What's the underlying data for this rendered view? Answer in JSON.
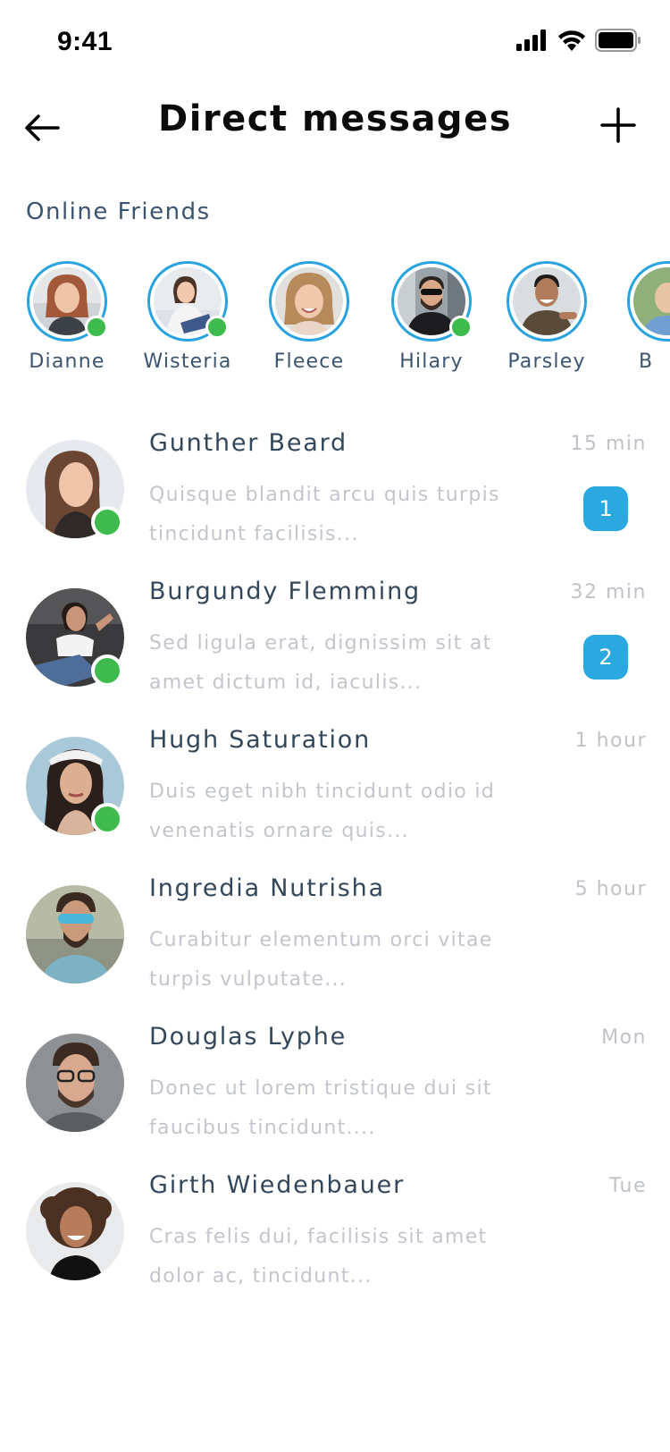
{
  "status_bar": {
    "time": "9:41"
  },
  "header": {
    "title": "Direct messages",
    "back_icon": "arrow-left-icon",
    "add_icon": "plus-icon"
  },
  "online_friends": {
    "title": "Online Friends",
    "friends": [
      {
        "name": "Dianne",
        "online": true
      },
      {
        "name": "Wisteria",
        "online": true
      },
      {
        "name": "Fleece",
        "online": false
      },
      {
        "name": "Hilary",
        "online": true
      },
      {
        "name": "Parsley",
        "online": false
      },
      {
        "name": "B",
        "online": false
      }
    ]
  },
  "conversations": [
    {
      "name": "Gunther Beard",
      "time": "15 min",
      "preview": "Quisque blandit arcu quis turpis tincidunt facilisis...",
      "unread": "1",
      "online": true
    },
    {
      "name": "Burgundy Flemming",
      "time": "32 min",
      "preview": "Sed ligula erat, dignissim sit at amet dictum id, iaculis...",
      "unread": "2",
      "online": true
    },
    {
      "name": "Hugh Saturation",
      "time": "1 hour",
      "preview": "Duis eget nibh tincidunt odio id venenatis ornare quis...",
      "unread": "",
      "online": true
    },
    {
      "name": "Ingredia Nutrisha",
      "time": "5 hour",
      "preview": "Curabitur elementum orci vitae turpis vulputate...",
      "unread": "",
      "online": false
    },
    {
      "name": "Douglas Lyphe",
      "time": "Mon",
      "preview": "Donec ut lorem tristique dui sit faucibus tincidunt....",
      "unread": "",
      "online": false
    },
    {
      "name": "Girth Wiedenbauer",
      "time": "Tue",
      "preview": "Cras felis dui, facilisis sit amet dolor ac, tincidunt...",
      "unread": "",
      "online": false
    }
  ],
  "colors": {
    "accent": "#29a3e0",
    "online": "#3ebb4c",
    "badge": "#2aa8e0",
    "name_text": "#33475b",
    "muted_text": "#c2c6cc"
  }
}
